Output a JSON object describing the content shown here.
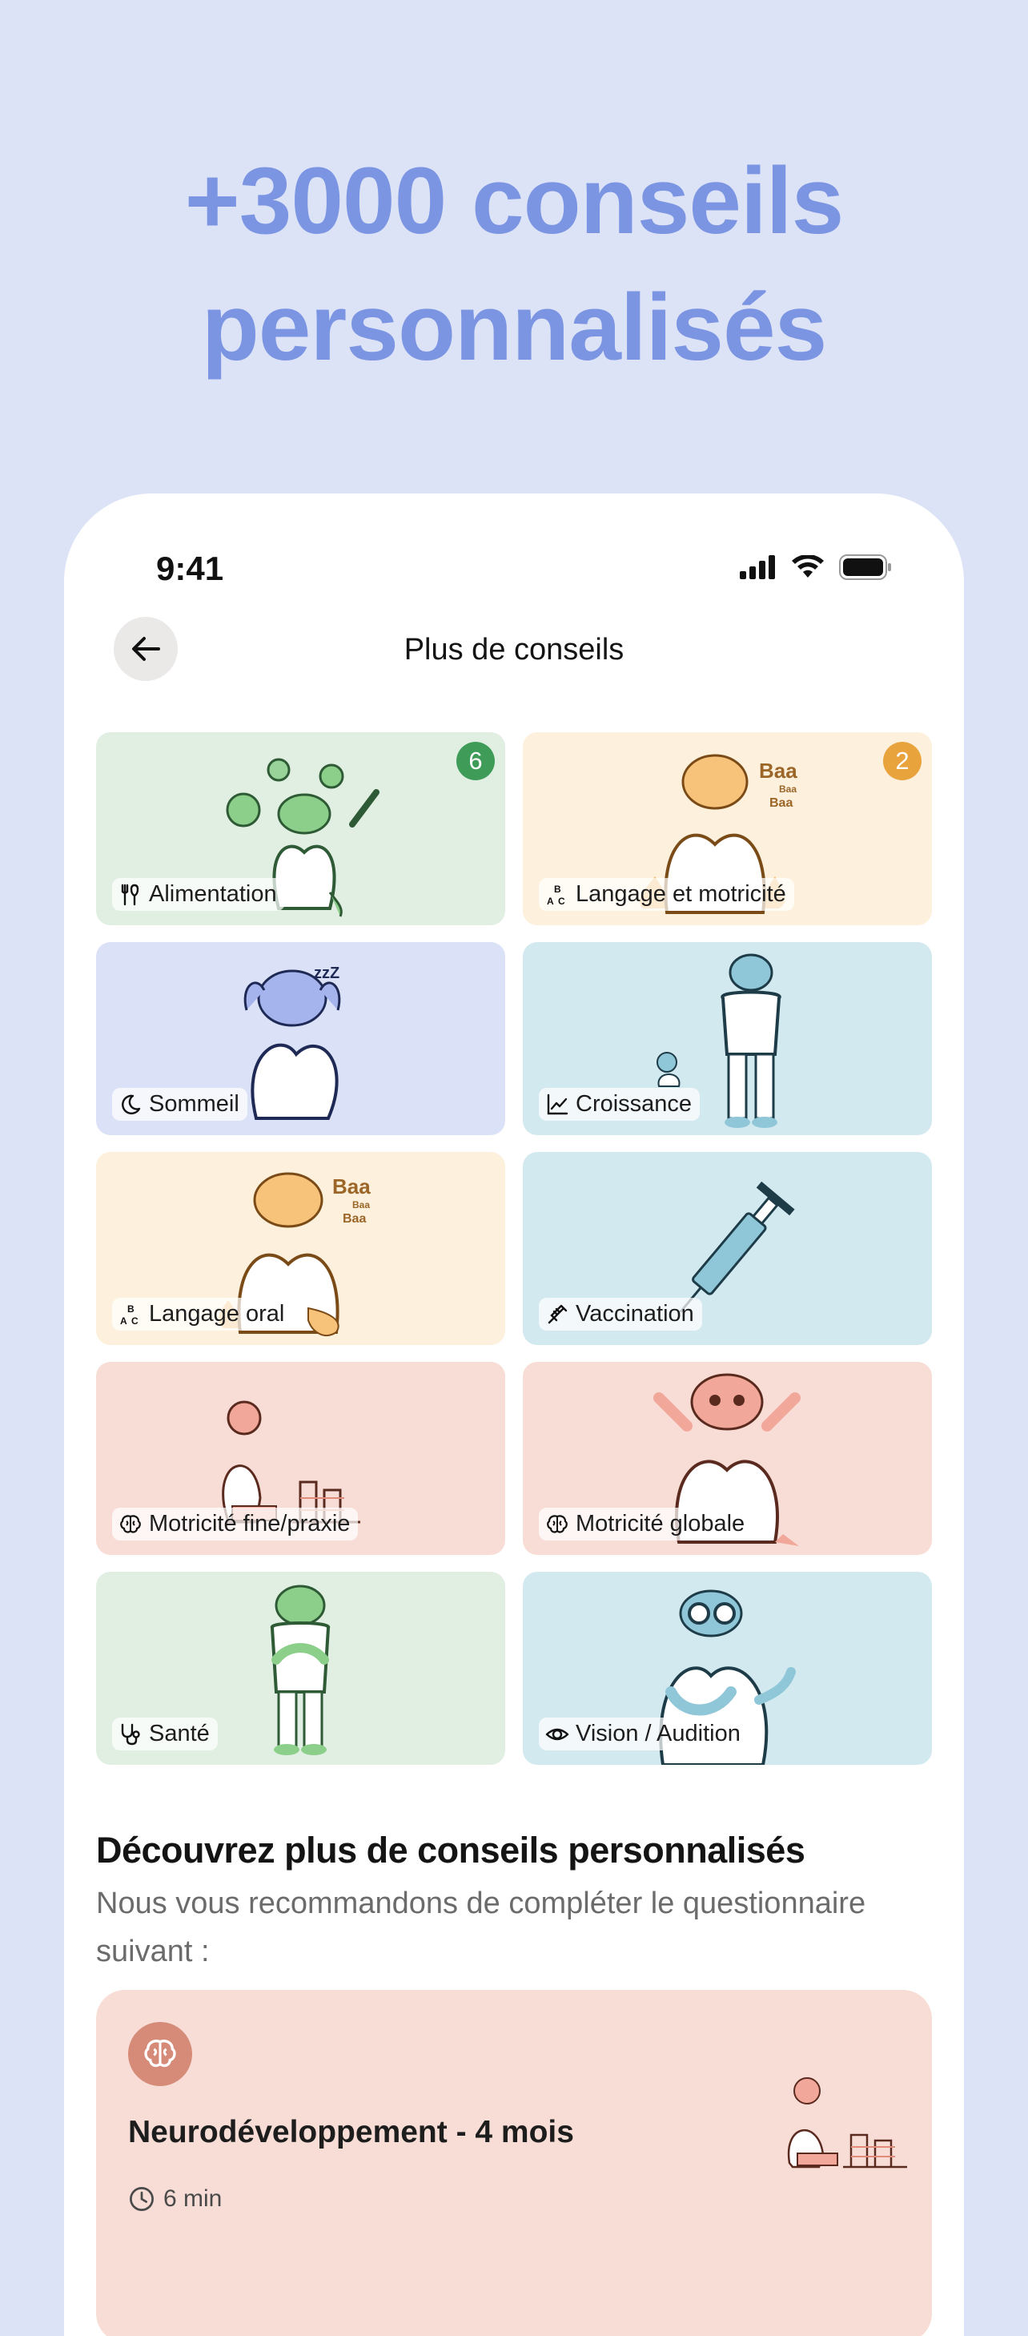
{
  "headline": {
    "line1": "+3000 conseils",
    "line2": "personnalisés"
  },
  "status_bar": {
    "time": "9:41"
  },
  "nav": {
    "title": "Plus de conseils",
    "back_icon": "arrow-left-icon"
  },
  "categories": [
    {
      "label": "Alimentation",
      "icon": "cutlery-icon",
      "badge": "6",
      "badge_color": "#3f9b58",
      "bg": "#e1efe3"
    },
    {
      "label": "Langage et motricité",
      "icon": "abc-icon",
      "badge": "2",
      "badge_color": "#e9a33d",
      "bg": "#fdf0dc"
    },
    {
      "label": "Sommeil",
      "icon": "moon-icon",
      "bg": "#dbe1f6"
    },
    {
      "label": "Croissance",
      "icon": "chart-line-icon",
      "bg": "#d3e9f0"
    },
    {
      "label": "Langage oral",
      "icon": "abc-icon",
      "bg": "#fdf0dc"
    },
    {
      "label": "Vaccination",
      "icon": "syringe-icon",
      "bg": "#d3e9f0"
    },
    {
      "label": "Motricité fine/praxie",
      "icon": "brain-icon",
      "bg": "#f8ddd6"
    },
    {
      "label": "Motricité globale",
      "icon": "brain-icon",
      "bg": "#f8ddd6"
    },
    {
      "label": "Santé",
      "icon": "stethoscope-icon",
      "bg": "#e1efe3"
    },
    {
      "label": "Vision / Audition",
      "icon": "eye-icon",
      "bg": "#d3e9f0"
    }
  ],
  "discover": {
    "title": "Découvrez plus de conseils personnalisés",
    "subtitle": "Nous vous recommandons de compléter le questionnaire suivant :"
  },
  "questionnaire": {
    "title": "Neurodéveloppement - 4 mois",
    "duration": "6 min",
    "icon": "brain-icon",
    "icon_bg": "#d68a78"
  }
}
